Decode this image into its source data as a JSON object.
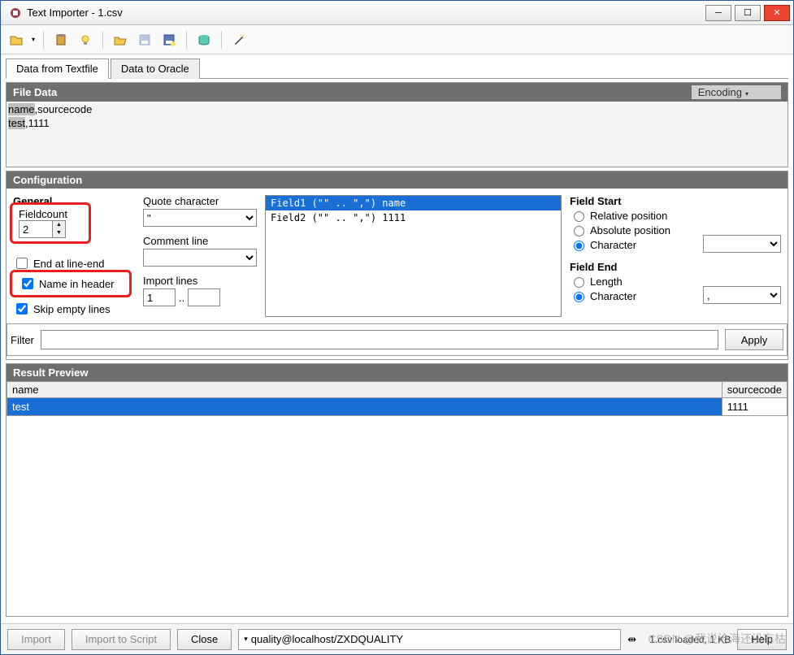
{
  "window": {
    "title": "Text Importer - 1.csv"
  },
  "tabs": {
    "active": "Data from Textfile",
    "other": "Data to Oracle"
  },
  "file_data": {
    "header": "File Data",
    "encoding_label": "Encoding",
    "line1_col1": "name",
    "line1_rest": ",sourcecode",
    "line2_col1": "test",
    "line2_rest": ",1111"
  },
  "config": {
    "header": "Configuration",
    "general_label": "General",
    "fieldcount_label": "Fieldcount",
    "fieldcount_value": "2",
    "end_at_line_end": "End at line-end",
    "name_in_header": "Name in header",
    "skip_empty": "Skip empty lines",
    "quote_label": "Quote character",
    "quote_value": "\"",
    "comment_label": "Comment line",
    "comment_value": "",
    "import_lines_label": "Import lines",
    "import_lines_from": "1",
    "import_lines_sep": "..",
    "fields": [
      "Field1  (\"\" .. \",\")  name",
      "Field2  (\"\" .. \",\")  1111"
    ],
    "field_start_label": "Field Start",
    "fs_relative": "Relative position",
    "fs_absolute": "Absolute position",
    "fs_character": "Character",
    "fs_char_value": "",
    "field_end_label": "Field End",
    "fe_length": "Length",
    "fe_character": "Character",
    "fe_char_value": ","
  },
  "filter": {
    "label": "Filter",
    "value": "",
    "apply": "Apply"
  },
  "result": {
    "header": "Result Preview",
    "cols": [
      "name",
      "sourcecode"
    ],
    "row": [
      "test",
      "1111"
    ]
  },
  "bottom": {
    "import": "Import",
    "import_script": "Import to Script",
    "close": "Close",
    "connection": "quality@localhost/ZXDQUALITY",
    "status": "1.csv loaded,  1 KB",
    "help": "Help"
  },
  "watermark": "CSDN @我说沧海还没有枯"
}
